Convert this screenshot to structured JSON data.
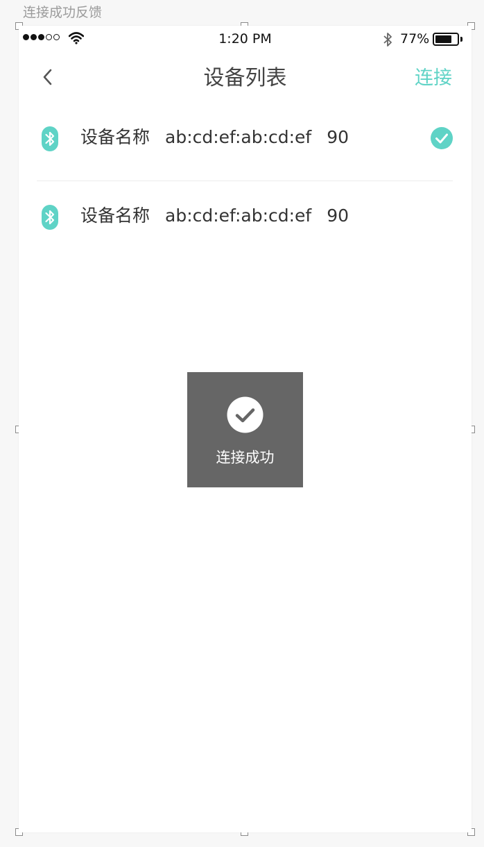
{
  "artboard": {
    "label": "连接成功反馈"
  },
  "status_bar": {
    "signal_dots": [
      "filled",
      "filled",
      "filled",
      "empty",
      "empty"
    ],
    "wifi_icon": "wifi-icon",
    "time": "1:20 PM",
    "bluetooth_icon": "bluetooth-icon",
    "battery_percent": "77%",
    "battery_level": 0.77
  },
  "nav": {
    "back_icon": "chevron-left-icon",
    "title": "设备列表",
    "connect_label": "连接"
  },
  "devices": [
    {
      "name": "设备名称",
      "mac": "ab:cd:ef:ab:cd:ef",
      "rssi": "90",
      "selected": true
    },
    {
      "name": "设备名称",
      "mac": "ab:cd:ef:ab:cd:ef",
      "rssi": "90",
      "selected": false
    }
  ],
  "toast": {
    "icon": "check-circle-icon",
    "message": "连接成功"
  },
  "colors": {
    "accent": "#5fd3c6",
    "toast_bg": "#666666",
    "text": "#333333"
  }
}
